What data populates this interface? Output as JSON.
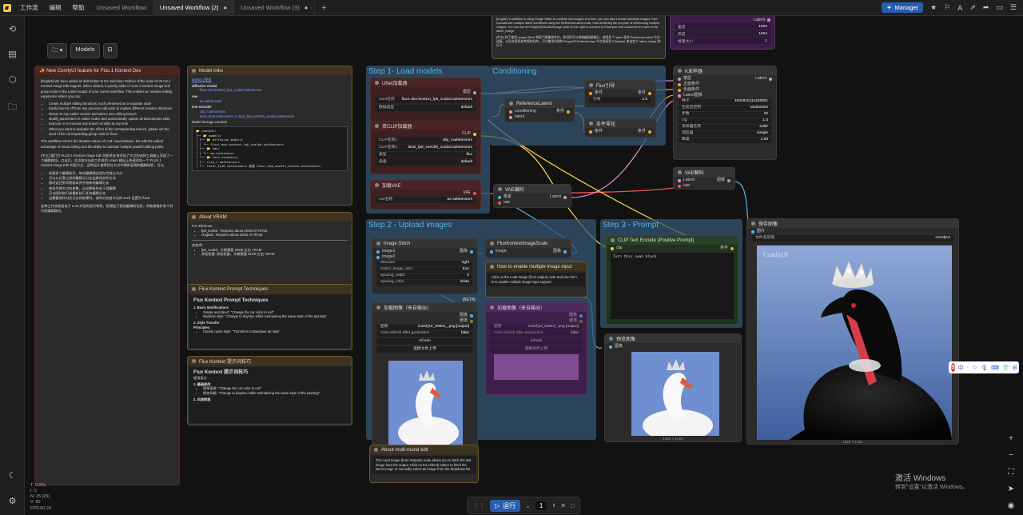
{
  "topbar": {
    "menus": [
      "工作流",
      "编辑",
      "帮助"
    ],
    "tabs": [
      {
        "label": "Unsaved Workflow",
        "active": false,
        "dirty": false
      },
      {
        "label": "Unsaved Workflow (2)",
        "active": true,
        "dirty": true
      },
      {
        "label": "Unsaved Workflow (3)",
        "active": false,
        "dirty": true
      }
    ],
    "manager_label": "Manager"
  },
  "toolbox": {
    "models_label": "Models"
  },
  "groups": {
    "load_models": "Step 1- Load models",
    "conditioning": "Conditioning",
    "upload_images": "Step 2 - Upload images",
    "prompt": "Step 3 - Prompt"
  },
  "notes": {
    "new_feature": {
      "title": "✨ New ComfyUI feature for Flux.1 Kontext Dev",
      "en_intro": "[English] We have added an Edit button to the Selection Toolbox of the node for FLUX.1 Kontext Image Edit support. When clicked, it quickly adds a FLUX.1 Kontext Image Edit group node to the Latent output of your current workflow. This enables an intuitive editing experience where you can:",
      "en_bullets": [
        "Create multiple editing iterations, each preserved as a separate node",
        "Easily branch off from any previous edit point to explore different creative directions",
        "Return to any earlier version and start a new editing branch",
        "Modify parameters in earlier nodes and automatically update all downstream edits",
        "Execute or re-execute any branch of edits at any time",
        "When you want to maintain the effect of the corresponding branch, please set the seed of the corresponding group node to fixed."
      ],
      "en_outro": "This workflow mirrors the iterative nature of LLM conversations, but with the added advantage of visual editing and the ability to maintain multiple parallel editing paths.",
      "zh_intro": "[中文] 我们为 FLUX.1 Kontext Image Edit 的相关支持添加了节点的选择工具箱上添加了一个编辑按钮，点击后，会添加在当前工作流的 Latent 输出上快速添加一个 FLUX.1 Kontext Image Edit 的组节点，这种设计使得您在节点中拥有直观的编辑体验，可以：",
      "zh_bullets": [
        "创建多个编辑迭代，每次编辑都会保存为独立节点",
        "可以从任意之前的编辑点分支出新的创作方向",
        "随时返回到早期版本并开始新的编辑分支",
        "修改早期节点的参数，自动更新所有下游编辑",
        "可以随时执行或重新执行任何编辑分支",
        "当需要保持对应分支的效果时，请将对应组节点的 seed 设置为 fixed"
      ],
      "zh_outro": "这种工作流程类似于 LLM 对话的迭代特性，但增加了视觉编辑的优势，并能够维护多个并行的编辑路径。"
    },
    "model_links": {
      "title": "Model links",
      "tutorial": "tutorial | 教程",
      "diffusion_label": "diffusion model",
      "diffusion_file": "flux1-dev-kontext_fp8_scaled.safetensors",
      "vae_label": "vae",
      "vae_file": "ae.safetensors",
      "text_label": "text encoder",
      "clip_l": "clip_l.safetensors",
      "t5": "t5xxl_fp16.safetensors or t5xxl_fp8_e4m3fn_scaled.safetensors",
      "storage": "Model Storage Location",
      "tree": [
        "📂 ComfyUI/",
        "├── 📂 models/",
        "│   ├── 📂 diffusion_models/",
        "│   │   └── flux1-dev-kontext_fp8_scaled.safetensors",
        "│   ├── 📂 vae/",
        "│   │   └── ae.safetensor",
        "│   └── 📂 text_encoders/",
        "│       ├── clip_l.safetensors",
        "│       └── t5xxl_fp16.safetensors 或者 t5xxl_fp8_e4m3fn_scaled.safetensors"
      ]
    },
    "vram": {
      "title": "About VRAM",
      "ref": "For reference:",
      "items": [
        "fp8_scaled : Requires about 20GB of VRAM.",
        "Original : Requires about 32GB of VRAM."
      ],
      "zh_ref": "仅参考：",
      "zh_items": [
        "fp8_scaled : 大概需要 20GB 左右 VRAM",
        "原始权重: 原始权重，大概需要 32GB 左右 VRAM"
      ]
    },
    "prompt_tech": {
      "title": "Flux Kontext Prompt Techniques",
      "h1": "Flux Kontext Prompt Techniques",
      "s1": "1. Basic Modifications",
      "s1_items": [
        "Simple and direct: \"Change the car color to red\"",
        "Maintain style: \"Change to daytime while maintaining the same style of the painting\""
      ],
      "s2": "2. Style Transfer",
      "principles": "Principles:",
      "p_items": [
        "Clearly name style: \"Transform to Bauhaus art style\""
      ]
    },
    "prompt_tech_zh": {
      "title": "Flux Kontext 提示词技巧",
      "h1": "Flux Kontext 提示词技巧",
      "intro": "使用英文",
      "s1": "1. 基础修改",
      "s1_items": [
        "简单直接: \"Change the car color to red\"",
        "保持风格: \"Change to daytime while maintaining the same style of the painting\""
      ],
      "s2": "2. 风格转换"
    },
    "multi_round": {
      "title": "About multi-round edit",
      "text": "The Load Image (from Outputs) node allows you to fetch the last image from the output. Click on the refresh button to fetch the latest image or manually select an image from the dropdown list."
    },
    "reference_top": {
      "en": "[English] In addition to using Image Stitch to combine two images at a time, you can also encode individual images, then concatenate multiple latent conditions using the ReferenceLatent node, thus achieving the purpose of referencing multiple images. You can use the EmptySD3LatentImage node on the right to connect to KSampler and customize the size of the latent_image.",
      "zh": "[中文] 除了使用 Image Stitch 将两个图像拼合外，你同样可以单独编码图像后，使用多个 latent 条件 ReferenceLatent 节点连接，从而实现多参考图的目的。可以使用右侧的 EmptySD3LatentImage 节点连接到 KSampler 来自定义 latent_image 的尺寸"
    },
    "multi_image": {
      "title": "How to enable multiple image input",
      "text": "Click on the Load Image (from output) node and use Ctrl + B to enable multiple image input support."
    }
  },
  "nodes": {
    "unet": {
      "title": "UNet加载器",
      "out": "模型",
      "w1_label": "Unet名称",
      "w1_value": "flux1-dev-kontext_fp8_scaled.safetensors",
      "w2_label": "数据类型",
      "w2_value": "default"
    },
    "clip": {
      "title": "双CLIP加载器",
      "out": "CLIP",
      "w1_label": "CLIP名称1",
      "w1_value": "clip_l.safetensors",
      "w2_label": "CLIP名称2",
      "w2_value": "t5xxl_fp8_e4m3fn_scaled.safetensors",
      "w3_label": "类型",
      "w3_value": "flux",
      "w4_label": "设备",
      "w4_value": "default"
    },
    "vae": {
      "title": "加载VAE",
      "out": "VAE",
      "w1_label": "vae名称",
      "w1_value": "ae.safetensors"
    },
    "flux_guidance": {
      "title": "Flux引导",
      "in": "条件",
      "out": "条件",
      "w1_label": "引导",
      "w1_value": "2.5"
    },
    "ref_latent": {
      "title": "ReferenceLatent",
      "in1": "conditioning",
      "in2": "latent",
      "out": "条件"
    },
    "cond_zero": {
      "title": "条件零化",
      "in": "条件",
      "out": "条件"
    },
    "ksampler": {
      "title": "K采样器",
      "inputs": [
        "模型",
        "正面条件",
        "负面条件",
        "Latent图像"
      ],
      "out": "Latent",
      "widgets": [
        {
          "label": "种子",
          "value": "1004815111226001"
        },
        {
          "label": "生成后控制",
          "value": "randomize"
        },
        {
          "label": "步数",
          "value": "20"
        },
        {
          "label": "cfg",
          "value": "1.0"
        },
        {
          "label": "采样器名称",
          "value": "euler"
        },
        {
          "label": "调度器",
          "value": "simple"
        },
        {
          "label": "降噪",
          "value": "1.00"
        }
      ]
    },
    "vae_decode": {
      "title": "VAE解码",
      "in1": "Latent",
      "in2": "vae",
      "out": "图像"
    },
    "vae_encode": {
      "title": "VAE编码",
      "in1": "像素",
      "in2": "vae",
      "out": "Latent"
    },
    "save_image": {
      "title": "保存图像",
      "in": "图片",
      "w1_label": "文件名前缀",
      "w1_value": "ComfyUI",
      "caption": "1024 × 1024",
      "watermark": "ComfyUI"
    },
    "image_stitch": {
      "title": "Image Stitch",
      "in1": "image1",
      "in2": "image2",
      "out": "图像",
      "widgets": [
        {
          "label": "direction",
          "value": "right"
        },
        {
          "label": "match_image_size",
          "value": "true"
        },
        {
          "label": "spacing_width",
          "value": "0"
        },
        {
          "label": "spacing_color",
          "value": "white"
        }
      ],
      "beta": "[BETA]"
    },
    "kontext_scale": {
      "title": "FluxKontextImageScale",
      "in": "image",
      "out": "图像"
    },
    "load_image_1": {
      "title": "加载图像（来自输出）",
      "out1": "图像",
      "out2": "遮罩",
      "w1_label": "图像",
      "w1_value": "ComfyUI_00001_.png [output]",
      "w2_label": "Auto-refresh after generation",
      "w2_value": "false",
      "refresh": "refresh",
      "upload": "选择文件上传",
      "caption": "1024 × 1024"
    },
    "load_image_2": {
      "title": "加载图像（来自输出）",
      "out1": "图像",
      "out2": "遮罩",
      "w1_label": "图像",
      "w1_value": "Comfyui_00010_.png [output]",
      "w2_label": "Auto-refresh after generation",
      "w2_value": "false",
      "refresh": "refresh",
      "upload": "选择文件上传"
    },
    "clip_text": {
      "title": "CLIP Text Encode (Positive Prompt)",
      "in": "clip",
      "out": "条件",
      "text": "Turn this swan black"
    },
    "preview": {
      "title": "预览图像",
      "in": "图像",
      "caption": "1024 × 1024"
    },
    "empty_latent": {
      "widgets": [
        {
          "label": "宽度",
          "value": "1024"
        },
        {
          "label": "高度",
          "value": "1024"
        },
        {
          "label": "批量大小",
          "value": "1"
        }
      ],
      "out": "Latent"
    }
  },
  "runbar": {
    "run_label": "运行",
    "count": "1"
  },
  "stats": [
    "T: 0.00s",
    "I: 0",
    "N: 25 [25]",
    "V: 82",
    "FPS:60.24"
  ],
  "watermark": {
    "line1": "激活 Windows",
    "line2": "转到\"设置\"以激活 Windows。"
  },
  "ime": {
    "s": "S",
    "items": [
      "中",
      "·",
      "☺",
      "🎙",
      "⌨",
      "👕",
      "⊞"
    ]
  },
  "colors": {
    "accent": "#2a5db0",
    "group_blue": "#345572",
    "wire_yellow": "#f2c94c",
    "wire_pink": "#e58ad5",
    "wire_red": "#e55",
    "wire_blue": "#5ab0e6",
    "wire_orange": "#f0a23a"
  }
}
